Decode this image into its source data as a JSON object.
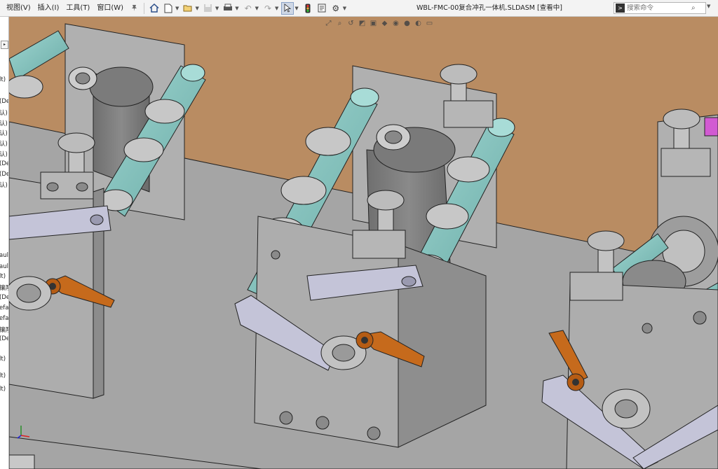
{
  "menu": [
    {
      "id": "view",
      "label": "视图(V)"
    },
    {
      "id": "insert",
      "label": "插入(I)"
    },
    {
      "id": "tools",
      "label": "工具(T)"
    },
    {
      "id": "window",
      "label": "窗口(W)"
    }
  ],
  "toolbar": {
    "pin_icon": "pin-icon",
    "items": [
      "home-icon",
      "new-document-icon",
      "open-icon",
      "save-icon",
      "print-icon",
      "undo-icon",
      "redo-icon",
      "select-pointer-icon",
      "traffic-light-icon",
      "options-gear-icon"
    ]
  },
  "document": {
    "title": "WBL-FMC-00复合冲孔一体机.SLDASM [查看中]"
  },
  "search": {
    "placeholder": "搜索命令",
    "prompt_icon": "command-prompt-icon",
    "search_icon": "magnifier-icon"
  },
  "tree_fragments": [
    "lt)",
    "(De",
    "认)",
    "认)",
    "认)",
    "认)",
    "认)",
    "(De",
    "(De",
    "认)",
    "aul",
    "aul",
    "lt)",
    "攘厚",
    "(De",
    "efa",
    "efa",
    "攘厚",
    "(De",
    "lt)",
    "lt)",
    "lt)"
  ],
  "heads_up_toolbar": [
    "zoom-to-fit-icon",
    "zoom-area-icon",
    "previous-view-icon",
    "section-view-icon",
    "view-orientation-icon",
    "display-style-icon",
    "hide-show-icon",
    "edit-appearance-icon",
    "scene-icon",
    "view-settings-icon"
  ],
  "colors": {
    "background_floor": "#b98c62",
    "base_plate": "#a5a5a5",
    "bracket": "#b3b3b3",
    "roller": "#7fbfbb",
    "lever": "#c66a1c",
    "link_arm": "#c4c4d8",
    "accent_magenta": "#d25ad2"
  }
}
